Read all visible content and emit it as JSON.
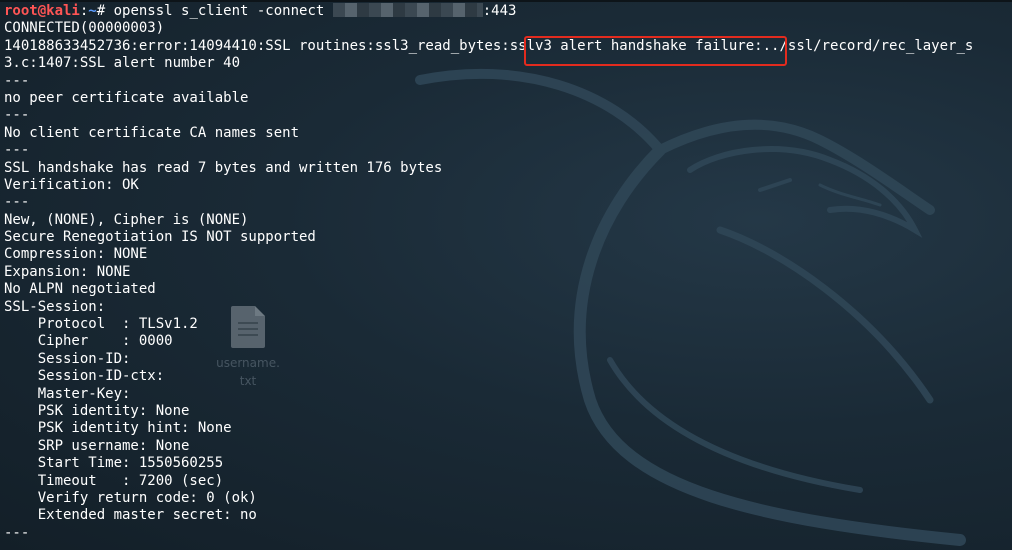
{
  "desktop": {
    "file_icon_label_1": "username.",
    "file_icon_label_2": "txt"
  },
  "terminal": {
    "prompt_user": "root@kali",
    "prompt_sep": ":",
    "prompt_path": "~",
    "prompt_hash": "# ",
    "command": "openssl s_client -connect",
    "command_port": ":443",
    "error_prefix": "140188633452736:error:14094410:SSL routines:ssl3_read_bytes:",
    "error_highlight": "sslv3 alert handshake failure",
    "error_suffix": ":../ssl/record/rec_layer_s",
    "lines": [
      "CONNECTED(00000003)",
      "3.c:1407:SSL alert number 40",
      "---",
      "no peer certificate available",
      "---",
      "No client certificate CA names sent",
      "---",
      "SSL handshake has read 7 bytes and written 176 bytes",
      "Verification: OK",
      "---",
      "New, (NONE), Cipher is (NONE)",
      "Secure Renegotiation IS NOT supported",
      "Compression: NONE",
      "Expansion: NONE",
      "No ALPN negotiated",
      "SSL-Session:",
      "    Protocol  : TLSv1.2",
      "    Cipher    : 0000",
      "    Session-ID:",
      "    Session-ID-ctx:",
      "    Master-Key:",
      "    PSK identity: None",
      "    PSK identity hint: None",
      "    SRP username: None",
      "    Start Time: 1550560255",
      "    Timeout   : 7200 (sec)",
      "    Verify return code: 0 (ok)",
      "    Extended master secret: no",
      "---"
    ]
  }
}
